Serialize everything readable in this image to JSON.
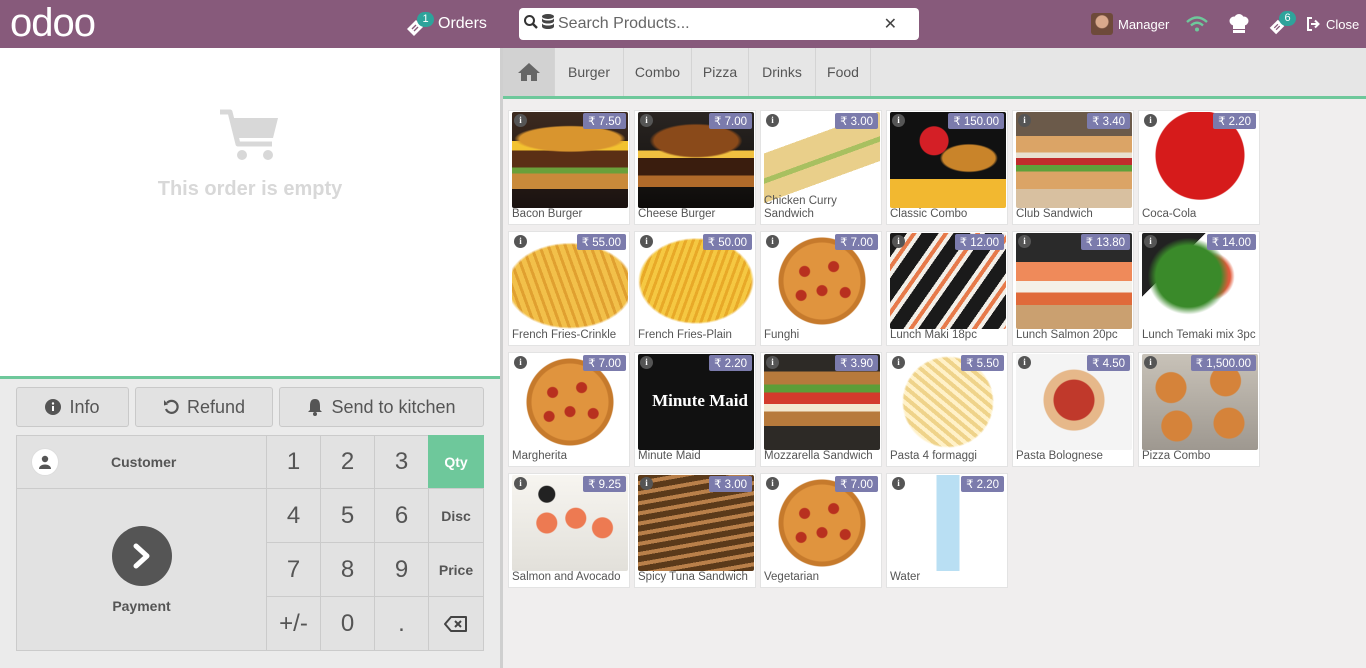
{
  "header": {
    "logo_text": "odoo",
    "orders_label": "Orders",
    "orders_count": "1",
    "search_placeholder": "Search Products...",
    "user_name": "Manager",
    "sync_count": "6",
    "close_label": "Close",
    "icons": [
      "ticket-icon",
      "search-icon",
      "database-icon",
      "clear-icon",
      "wifi-icon",
      "chef-hat-icon",
      "sync-ticket-icon",
      "sign-out-icon"
    ]
  },
  "order": {
    "empty_text": "This order is empty"
  },
  "controls": {
    "info_label": "Info",
    "refund_label": "Refund",
    "kitchen_label": "Send to kitchen"
  },
  "numpad": {
    "customer_label": "Customer",
    "payment_label": "Payment",
    "keys": [
      "1",
      "2",
      "3",
      "4",
      "5",
      "6",
      "7",
      "8",
      "9",
      "+/-",
      "0",
      "."
    ],
    "modes": [
      "Qty",
      "Disc",
      "Price"
    ],
    "selected_mode": "Qty",
    "colors": {
      "accent": "#6ec89b",
      "header": "#875a7b",
      "price_badge": "#7b7bac"
    }
  },
  "categories": [
    "Burger",
    "Combo",
    "Pizza",
    "Drinks",
    "Food"
  ],
  "products": [
    {
      "name": "Bacon Burger",
      "price": "₹ 7.50",
      "img": "burger"
    },
    {
      "name": "Cheese Burger",
      "price": "₹ 7.00",
      "img": "burger-dark"
    },
    {
      "name": "Chicken Curry Sandwich",
      "price": "₹ 3.00",
      "img": "sandwich-tri"
    },
    {
      "name": "Classic Combo",
      "price": "₹ 150.00",
      "img": "combo"
    },
    {
      "name": "Club Sandwich",
      "price": "₹ 3.40",
      "img": "club"
    },
    {
      "name": "Coca-Cola",
      "price": "₹ 2.20",
      "img": "cola"
    },
    {
      "name": "French Fries-Crinkle",
      "price": "₹ 55.00",
      "img": "fries"
    },
    {
      "name": "French Fries-Plain",
      "price": "₹ 50.00",
      "img": "fries2"
    },
    {
      "name": "Funghi",
      "price": "₹ 7.00",
      "img": "pizza"
    },
    {
      "name": "Lunch Maki 18pc",
      "price": "₹ 12.00",
      "img": "maki"
    },
    {
      "name": "Lunch Salmon 20pc",
      "price": "₹ 13.80",
      "img": "salmon"
    },
    {
      "name": "Lunch Temaki mix 3pc",
      "price": "₹ 14.00",
      "img": "temaki"
    },
    {
      "name": "Margherita",
      "price": "₹ 7.00",
      "img": "pizza"
    },
    {
      "name": "Minute Maid",
      "price": "₹ 2.20",
      "img": "minute"
    },
    {
      "name": "Mozzarella Sandwich",
      "price": "₹ 3.90",
      "img": "mozza"
    },
    {
      "name": "Pasta 4 formaggi",
      "price": "₹ 5.50",
      "img": "pasta"
    },
    {
      "name": "Pasta Bolognese",
      "price": "₹ 4.50",
      "img": "bolognese"
    },
    {
      "name": "Pizza Combo",
      "price": "₹ 1,500.00",
      "img": "pizzacombo"
    },
    {
      "name": "Salmon and Avocado",
      "price": "₹ 9.25",
      "img": "salmonavo"
    },
    {
      "name": "Spicy Tuna Sandwich",
      "price": "₹ 3.00",
      "img": "panini"
    },
    {
      "name": "Vegetarian",
      "price": "₹ 7.00",
      "img": "pizza"
    },
    {
      "name": "Water",
      "price": "₹ 2.20",
      "img": "water"
    }
  ]
}
